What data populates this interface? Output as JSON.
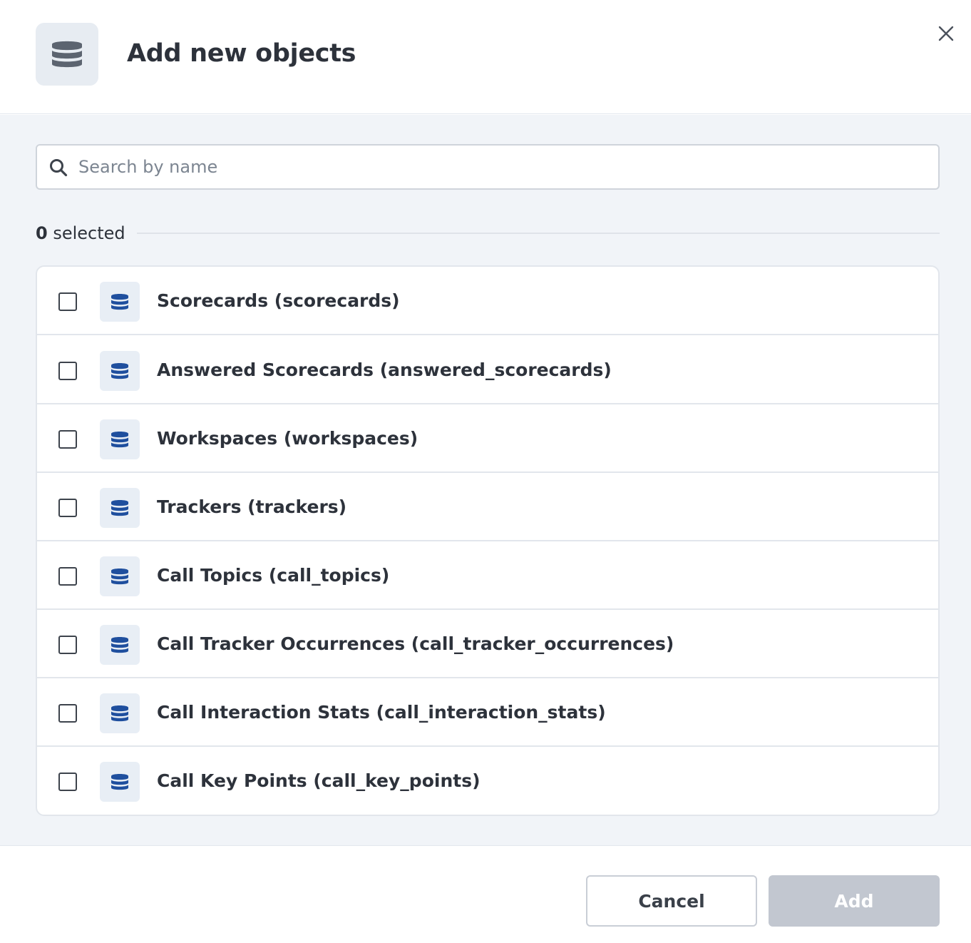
{
  "dialog": {
    "title": "Add new objects",
    "header_icon": "database-icon",
    "close_icon": "close-icon"
  },
  "search": {
    "placeholder": "Search by name",
    "value": "",
    "icon": "search-icon"
  },
  "selection": {
    "count": "0",
    "label": "selected"
  },
  "items": [
    {
      "label": "Scorecards (scorecards)",
      "checked": false,
      "icon": "database-icon"
    },
    {
      "label": "Answered Scorecards (answered_scorecards)",
      "checked": false,
      "icon": "database-icon"
    },
    {
      "label": "Workspaces (workspaces)",
      "checked": false,
      "icon": "database-icon"
    },
    {
      "label": "Trackers (trackers)",
      "checked": false,
      "icon": "database-icon"
    },
    {
      "label": "Call Topics (call_topics)",
      "checked": false,
      "icon": "database-icon"
    },
    {
      "label": "Call Tracker Occurrences (call_tracker_occurrences)",
      "checked": false,
      "icon": "database-icon"
    },
    {
      "label": "Call Interaction Stats (call_interaction_stats)",
      "checked": false,
      "icon": "database-icon"
    },
    {
      "label": "Call Key Points (call_key_points)",
      "checked": false,
      "icon": "database-icon"
    }
  ],
  "footer": {
    "cancel_label": "Cancel",
    "add_label": "Add",
    "add_disabled": true
  },
  "colors": {
    "item_icon": "#1f4f9e",
    "header_icon": "#5c6470",
    "add_disabled_bg": "#c2c7d0"
  }
}
